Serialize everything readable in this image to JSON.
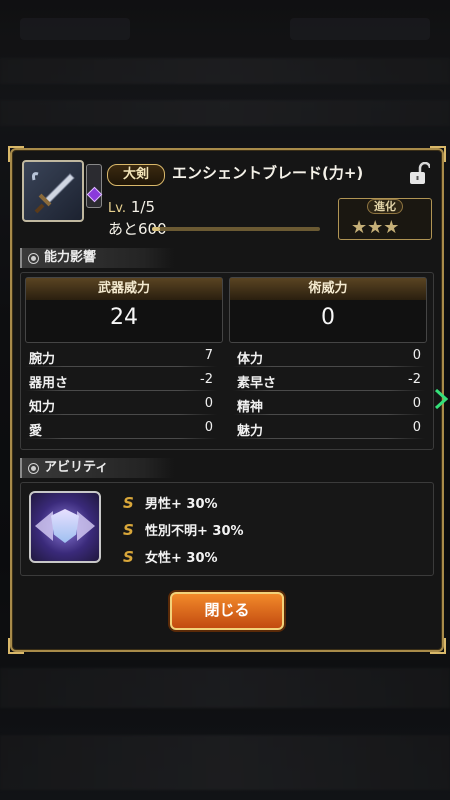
{
  "weapon": {
    "type": "大剣",
    "name": "エンシェントブレード(力+)",
    "level_prefix": "Lv.",
    "level": "1/5",
    "exp_remaining": "あと600",
    "exp_progress": 0.05,
    "evolution_label": "進化",
    "evolution_stars": "★★★"
  },
  "sections": {
    "stats_title": "能力影響",
    "ability_title": "アビリティ"
  },
  "power": {
    "weapon_label": "武器威力",
    "weapon_value": "24",
    "magic_label": "術威力",
    "magic_value": "0"
  },
  "stats_left": [
    {
      "label": "腕力",
      "value": "7"
    },
    {
      "label": "器用さ",
      "value": "-2"
    },
    {
      "label": "知力",
      "value": "0"
    },
    {
      "label": "愛",
      "value": "0"
    }
  ],
  "stats_right": [
    {
      "label": "体力",
      "value": "0"
    },
    {
      "label": "素早さ",
      "value": "-2"
    },
    {
      "label": "精神",
      "value": "0"
    },
    {
      "label": "魅力",
      "value": "0"
    }
  ],
  "abilities": [
    {
      "symbol": "S",
      "text": "男性+ 30%"
    },
    {
      "symbol": "S",
      "text": "性別不明+ 30%"
    },
    {
      "symbol": "S",
      "text": "女性+ 30%"
    }
  ],
  "close_label": "閉じる",
  "colors": {
    "frame_gold": "#a88b4a",
    "button_orange": "#e0661c",
    "arrow_green": "#35e07a"
  }
}
